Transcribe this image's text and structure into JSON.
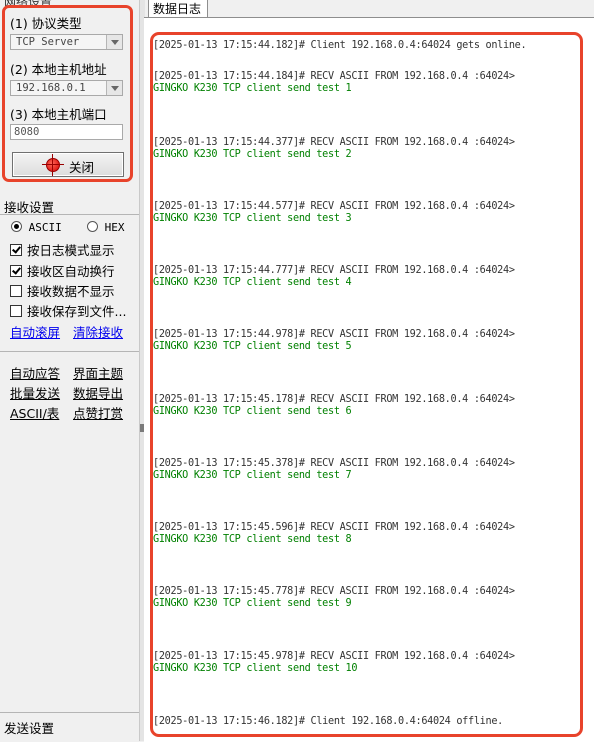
{
  "net_settings": {
    "title": "网络设置",
    "protocol_label": "(1) 协议类型",
    "protocol_value": "TCP Server",
    "host_label": "(2) 本地主机地址",
    "host_value": "192.168.0.1",
    "port_label": "(3) 本地主机端口",
    "port_value": "8080",
    "close_button": "关闭"
  },
  "receive_settings": {
    "title": "接收设置",
    "radio_ascii": "ASCII",
    "radio_hex": "HEX",
    "radio_selected": "ASCII",
    "checks": [
      {
        "label": "按日志模式显示",
        "checked": true
      },
      {
        "label": "接收区自动换行",
        "checked": true
      },
      {
        "label": "接收数据不显示",
        "checked": false
      },
      {
        "label": "接收保存到文件...",
        "checked": false
      }
    ],
    "link_autoscroll": "自动滚屏",
    "link_clear": "清除接收"
  },
  "tools": {
    "auto_reply": "自动应答",
    "theme": "界面主题",
    "batch_send": "批量发送",
    "export": "数据导出",
    "ascii_table": "ASCII/表",
    "donate": "点赞打赏"
  },
  "send_settings": {
    "title": "发送设置"
  },
  "log_tab": {
    "label": "数据日志"
  },
  "log": [
    {
      "header": "[2025-01-13 17:15:44.182]# Client 192.168.0.4:64024 gets online.",
      "body": ""
    },
    {
      "header": "[2025-01-13 17:15:44.184]# RECV ASCII FROM 192.168.0.4 :64024>",
      "body": "GINGKO K230 TCP client send test 1"
    },
    {
      "header": "[2025-01-13 17:15:44.377]# RECV ASCII FROM 192.168.0.4 :64024>",
      "body": "GINGKO K230 TCP client send test 2"
    },
    {
      "header": "[2025-01-13 17:15:44.577]# RECV ASCII FROM 192.168.0.4 :64024>",
      "body": "GINGKO K230 TCP client send test 3"
    },
    {
      "header": "[2025-01-13 17:15:44.777]# RECV ASCII FROM 192.168.0.4 :64024>",
      "body": "GINGKO K230 TCP client send test 4"
    },
    {
      "header": "[2025-01-13 17:15:44.978]# RECV ASCII FROM 192.168.0.4 :64024>",
      "body": "GINGKO K230 TCP client send test 5"
    },
    {
      "header": "[2025-01-13 17:15:45.178]# RECV ASCII FROM 192.168.0.4 :64024>",
      "body": "GINGKO K230 TCP client send test 6"
    },
    {
      "header": "[2025-01-13 17:15:45.378]# RECV ASCII FROM 192.168.0.4 :64024>",
      "body": "GINGKO K230 TCP client send test 7"
    },
    {
      "header": "[2025-01-13 17:15:45.596]# RECV ASCII FROM 192.168.0.4 :64024>",
      "body": "GINGKO K230 TCP client send test 8"
    },
    {
      "header": "[2025-01-13 17:15:45.778]# RECV ASCII FROM 192.168.0.4 :64024>",
      "body": "GINGKO K230 TCP client send test 9"
    },
    {
      "header": "[2025-01-13 17:15:45.978]# RECV ASCII FROM 192.168.0.4 :64024>",
      "body": "GINGKO K230 TCP client send test 10"
    },
    {
      "header": "[2025-01-13 17:15:46.182]# Client 192.168.0.4:64024 offline.",
      "body": ""
    }
  ],
  "colors": {
    "highlight": "#e8432b",
    "recv_text": "#008000",
    "link": "#0000ee"
  }
}
